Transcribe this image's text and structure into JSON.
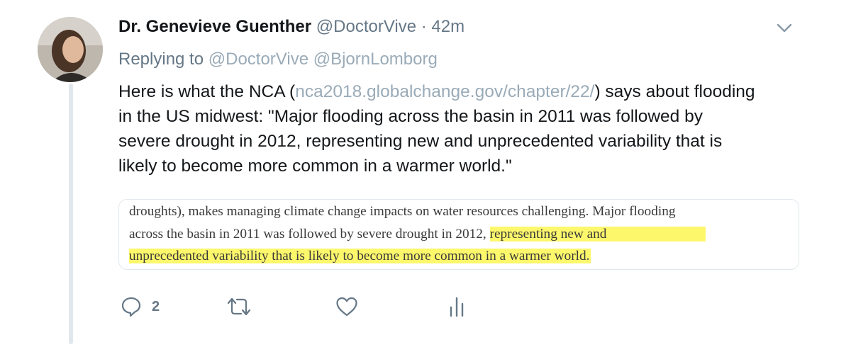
{
  "tweet": {
    "author_name": "Dr. Genevieve Guenther",
    "author_handle": "@DoctorVive",
    "separator": " · ",
    "time": "42m",
    "replying_prefix": "Replying to ",
    "replying_mentions": "@DoctorVive @BjornLomborg",
    "text_part1": "Here is what the NCA (",
    "text_link": "nca2018.globalchange.gov/chapter/22/",
    "text_part2": ") says about flooding in the US midwest: \"Major flooding across the basin in 2011 was followed by severe drought in 2012, representing new and unprecedented variability that is likely to become more common in a warmer world.\""
  },
  "quote_image": {
    "line1": "droughts), makes managing climate change impacts on water resources challenging. Major flooding",
    "line2_plain": "across the basin in 2011 was followed by severe drought in 2012, ",
    "line2_highlight": "representing new and",
    "line3_highlight": "unprecedented variability that is likely to become more common in a warmer world.",
    "highlight_color": "#fdf76c"
  },
  "actions": {
    "reply_icon": "reply-icon",
    "reply_count": "2",
    "retweet_icon": "retweet-icon",
    "like_icon": "heart-icon",
    "analytics_icon": "analytics-icon"
  },
  "colors": {
    "text": "#14171a",
    "secondary": "#657786",
    "link": "#9aabb8"
  }
}
